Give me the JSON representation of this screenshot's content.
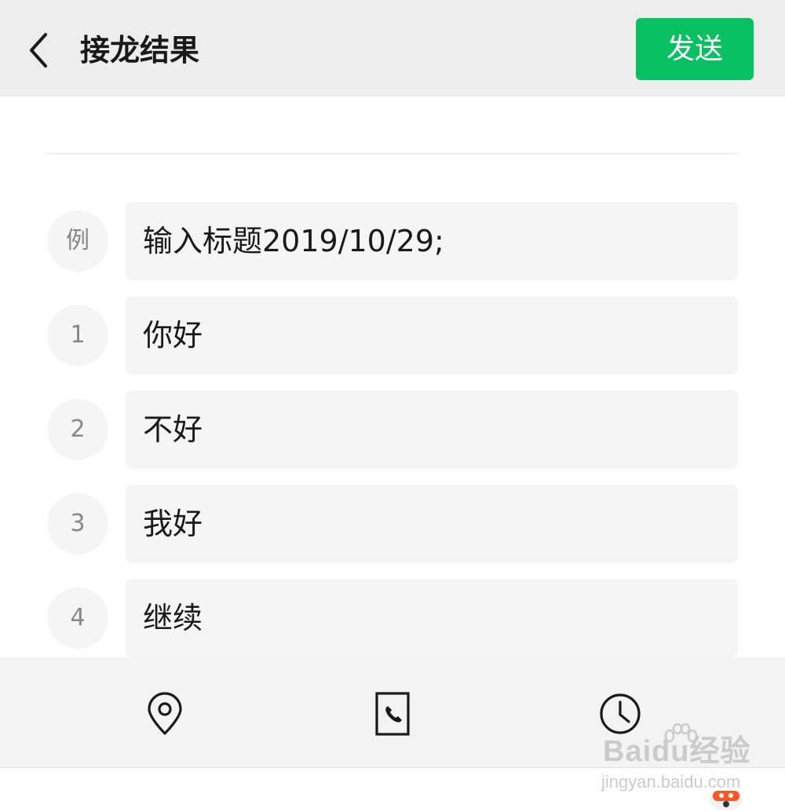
{
  "header": {
    "title": "接龙结果",
    "send_label": "发送"
  },
  "entries": [
    {
      "number": "例",
      "text": "输入标题2019/10/29;"
    },
    {
      "number": "1",
      "text": "你好"
    },
    {
      "number": "2",
      "text": "不好"
    },
    {
      "number": "3",
      "text": "我好"
    },
    {
      "number": "4",
      "text": "继续"
    }
  ],
  "toolbar": {
    "icons": [
      "location-icon",
      "phone-icon",
      "clock-icon"
    ]
  },
  "watermark": {
    "brand": "Baidu经验",
    "url": "jingyan.baidu.com"
  },
  "colors": {
    "accent": "#07c160",
    "header_bg": "#ededed",
    "field_bg": "#f5f5f5",
    "toolbar_bg": "#f3f3f3"
  }
}
